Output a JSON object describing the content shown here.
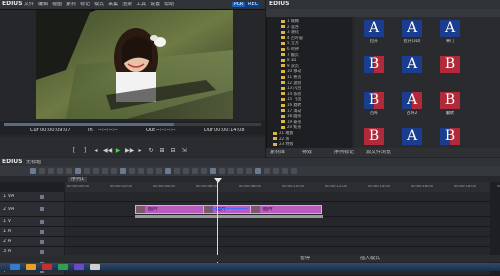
{
  "player": {
    "logo": "EDIUS",
    "menu": [
      "文件",
      "编辑",
      "视图",
      "素材",
      "标记",
      "模式",
      "采集",
      "渲染",
      "工具",
      "设置",
      "帮助"
    ],
    "mode_badge": "PLR",
    "rec_badge": "REC",
    "timecode_labels": [
      "Cur",
      "In",
      "Out",
      "Dur"
    ],
    "timecode_values": [
      "00:00:09:07",
      "--:--:--:--",
      "--:--:--:--",
      "00:00:14:08"
    ],
    "transport_icons": [
      "set-in-icon",
      "set-out-icon",
      "prev-frame-icon",
      "rewind-icon",
      "play-icon",
      "fast-forward-icon",
      "next-frame-icon",
      "loop-icon",
      "insert-icon",
      "overwrite-icon",
      "export-icon"
    ]
  },
  "bin": {
    "logo": "EDIUS",
    "tree_items": [
      "1 模糊",
      "2 混合",
      "3 溶化",
      "4 百叶窗",
      "5 立方",
      "6 时钟",
      "7 翻页",
      "8 3D",
      "9 双页",
      "10 移动",
      "11 卷页",
      "12 波纹",
      "13 闪白",
      "14 条纹",
      "15 飞出",
      "16 旋转",
      "17 滑动",
      "18 圆形",
      "19 菱形",
      "20 矩形",
      "21 缩放",
      "22 块",
      "23 特效"
    ],
    "thumbnails": [
      {
        "glyph": "A",
        "caption": "拉开",
        "style": "blue"
      },
      {
        "glyph": "A",
        "caption": "拉开(3D)",
        "style": "blue"
      },
      {
        "glyph": "A",
        "caption": "单门",
        "style": "blue"
      },
      {
        "glyph": "B",
        "caption": "",
        "style": "mixed"
      },
      {
        "glyph": "A",
        "caption": "",
        "style": "blue"
      },
      {
        "glyph": "B",
        "caption": "",
        "style": "red"
      },
      {
        "glyph": "B",
        "caption": "百叶",
        "style": "mixed"
      },
      {
        "glyph": "A",
        "caption": "百叶2",
        "style": "mixed"
      },
      {
        "glyph": "B",
        "caption": "翻转",
        "style": "red"
      },
      {
        "glyph": "B",
        "caption": "",
        "style": "red"
      },
      {
        "glyph": "A",
        "caption": "",
        "style": "blue"
      },
      {
        "glyph": "B",
        "caption": "",
        "style": "mixed"
      }
    ],
    "tabs": [
      "素材库",
      "特效",
      "序列标记",
      "源文件浏览"
    ]
  },
  "timeline": {
    "logo": "EDIUS",
    "title": "无标题",
    "sequence_tab": "序列1",
    "ruler_ticks": [
      "00:00:00:00",
      "00:00:02:00",
      "00:00:04:00",
      "00:00:06:00",
      "00:00:08:00",
      "00:00:10:00",
      "00:00:12:00",
      "00:00:14:00",
      "00:00:16:00",
      "00:00:18:00",
      "00:00:20:00"
    ],
    "tracks": [
      "1 VA",
      "2 VA",
      "1 V",
      "1 A",
      "2 A",
      "3 A",
      "4 A",
      "T"
    ],
    "clip_labels": [
      "图片",
      "图片",
      "图片"
    ],
    "status_left": "暂停",
    "status_right": "插入模式"
  },
  "taskbar": {
    "colors": [
      "#3a78c8",
      "#e8a020",
      "#c83030",
      "#30a050",
      "#6a4ac8",
      "#d0d0d0"
    ]
  }
}
